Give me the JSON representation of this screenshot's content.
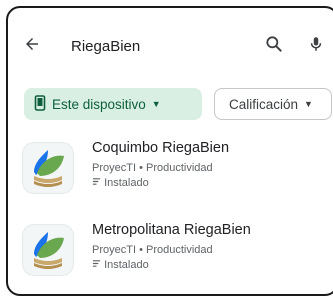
{
  "search": {
    "query": "RiegaBien"
  },
  "filters": [
    {
      "label": "Este dispositivo",
      "selected": true,
      "icon": "phone-icon"
    },
    {
      "label": "Calificación",
      "selected": false
    }
  ],
  "results": [
    {
      "name": "Coquimbo RiegaBien",
      "developer": "ProyecTI",
      "separator": "•",
      "category": "Productividad",
      "status": "Instalado",
      "icon": "leaf-water-drop-icon"
    },
    {
      "name": "Metropolitana RiegaBien",
      "developer": "ProyecTI",
      "separator": "•",
      "category": "Productividad",
      "status": "Instalado",
      "icon": "leaf-water-drop-icon"
    }
  ],
  "colors": {
    "chip_selected_bg": "#d9efe3",
    "chip_selected_text": "#0d5f3c",
    "leaf_green": "#6aa84f",
    "drop_blue": "#1a73e8"
  }
}
